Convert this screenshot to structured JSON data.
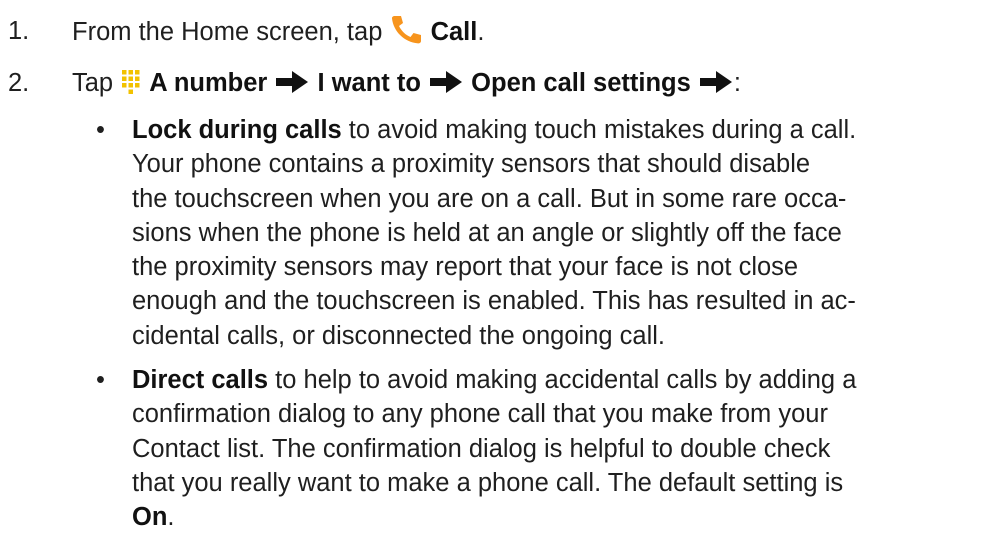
{
  "colors": {
    "accent": "#f7941d",
    "text": "#1f1f1f"
  },
  "steps": [
    {
      "number": "1.",
      "prefix": "From the Home screen, tap ",
      "icon": "phone-handset-icon",
      "label": "Call",
      "suffix": "."
    },
    {
      "number": "2.",
      "prefix": "Tap ",
      "icon": "dialpad-icon",
      "path": [
        "A number",
        "I want to",
        "Open call settings"
      ],
      "suffix": ":"
    }
  ],
  "bullets": [
    {
      "term": "Lock during calls",
      "lines": [
        " to avoid making touch mistakes during a call.",
        "Your phone contains a proximity sensors that should disable",
        "the touchscreen when you are on a call. But in some rare occa-",
        "sions when the phone is held at an angle or slightly off the face",
        "the proximity sensors may report that your face is not close",
        "enough and the touchscreen is enabled. This has resulted in ac-",
        "cidental calls, or disconnected the ongoing call."
      ]
    },
    {
      "term": "Direct calls",
      "lines": [
        " to help to avoid making accidental calls by adding a",
        "confirmation dialog to any phone call that you make from your",
        "Contact list. The confirmation dialog is helpful to double check",
        "that you really want to make a phone call. The default setting is"
      ],
      "last_bold": "On",
      "last_suffix": "."
    }
  ]
}
